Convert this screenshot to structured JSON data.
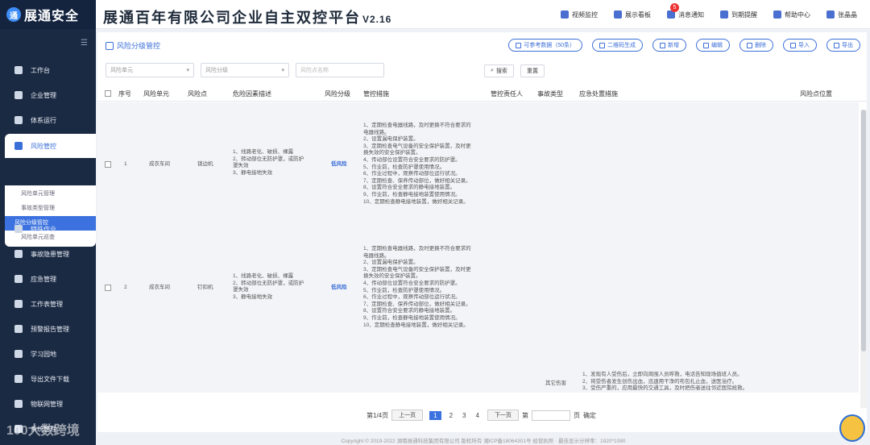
{
  "header": {
    "logo_mark": "通",
    "logo_text": "展通安全",
    "app_title": "展通百年有限公司企业自主双控平台",
    "version": "V2.16",
    "nav": [
      {
        "label": "视频监控",
        "icon": "video-icon"
      },
      {
        "label": "展示看板",
        "icon": "dashboard-icon"
      },
      {
        "label": "消息通知",
        "icon": "bell-icon",
        "badge": "5"
      },
      {
        "label": "到期提醒",
        "icon": "clock-icon"
      },
      {
        "label": "帮助中心",
        "icon": "help-icon"
      },
      {
        "label": "张晶晶",
        "icon": "user-icon"
      }
    ]
  },
  "sidebar": {
    "collapse_glyph": "☰",
    "items": [
      {
        "label": "工作台",
        "icon": "workbench-icon"
      },
      {
        "label": "企业管理",
        "icon": "home-icon"
      },
      {
        "label": "体系运行",
        "icon": "layers-icon"
      },
      {
        "label": "风险管控",
        "icon": "risk-icon"
      },
      {
        "label": "特殊作业",
        "icon": "hammer-icon"
      },
      {
        "label": "事故隐患管理",
        "icon": "hazard-icon"
      },
      {
        "label": "应急管理",
        "icon": "emergency-icon"
      },
      {
        "label": "工作表管理",
        "icon": "calendar-icon"
      },
      {
        "label": "预警报告管理",
        "icon": "report-icon"
      },
      {
        "label": "学习园地",
        "icon": "study-icon"
      },
      {
        "label": "导出文件下载",
        "icon": "download-icon"
      },
      {
        "label": "物联网管理",
        "icon": "iot-icon"
      },
      {
        "label": "系统管理",
        "icon": "settings-icon"
      }
    ],
    "submenu": [
      "风险单元管理",
      "事故类型管理",
      "风险分级管控",
      "风险单元巡查"
    ]
  },
  "panel": {
    "title": "风险分级管控",
    "toolbar": [
      {
        "label": "可参考数据（50条）",
        "icon": "eye-icon"
      },
      {
        "label": "二维码生成",
        "icon": "qrcode-icon"
      },
      {
        "label": "新增",
        "icon": "plus-icon"
      },
      {
        "label": "编辑",
        "icon": "edit-icon"
      },
      {
        "label": "删除",
        "icon": "delete-icon"
      },
      {
        "label": "导入",
        "icon": "import-icon"
      },
      {
        "label": "导出",
        "icon": "export-icon"
      }
    ],
    "filters": {
      "unit_placeholder": "风险单元",
      "level_placeholder": "风险分级",
      "point_placeholder": "风险点名称",
      "search_label": "搜索",
      "reset_label": "重置"
    }
  },
  "table": {
    "columns": [
      "序号",
      "风险单元",
      "风险点",
      "危险因素描述",
      "风险分级",
      "管控措施",
      "管控责任人",
      "事故类型",
      "应急处置措施",
      "风险点位置"
    ],
    "rows": [
      {
        "no": "1",
        "unit": "成衣车间",
        "point": "锁边机",
        "factors": [
          "1、线路老化、破损、裸露",
          "2、转动部位无防护罩，或防护",
          "罩失效",
          "3、静电接地失效"
        ],
        "level": "低风险",
        "measures": [
          "1、定期检查电器线路，及时更换不符合要求的",
          "电器线路。",
          "2、设置漏电保护装置。",
          "3、定期检查电气设备的安全保护装置，及时更",
          "换失效的安全保护装置。",
          "4、传动部位设置符合安全要求的防护罩。",
          "5、作业前，检查防护罩使用情况。",
          "6、作业过程中，观察传动部位运行状况。",
          "7、定期检查、保养传动部位，做好相关记录。",
          "8、设置符合安全要求的静电接地装置。",
          "9、作业前，检查静电接地装置使用情况。",
          "10、定期检查静电接地装置，做好相关记录。"
        ]
      },
      {
        "no": "2",
        "unit": "成衣车间",
        "point": "钉扣机",
        "factors": [
          "1、线路老化、破损、裸露",
          "2、转动部位无防护罩，或防护",
          "罩失效",
          "3、静电接地失效"
        ],
        "level": "低风险",
        "measures": [
          "1、定期检查电器线路，及时更换不符合要求的",
          "电器线路。",
          "2、设置漏电保护装置。",
          "3、定期检查电气设备的安全保护装置，及时更",
          "换失效的安全保护装置。",
          "4、传动部位设置符合安全要求的防护罩。",
          "5、作业前，检查防护罩使用情况。",
          "6、作业过程中，观察传动部位运行状况。",
          "7、定期检查、保养传动部位，做好相关记录。",
          "8、设置符合安全要求的静电接地装置。",
          "9、作业前，检查静电接地装置使用情况。",
          "10、定期检查静电接地装置，做好相关记录。"
        ]
      }
    ],
    "extra_row": {
      "accident_type": "其它伤害",
      "emergency": [
        "1、发现有人受伤后，立即向周围人员呼救，电话告知现场值班人员。",
        "2、将受伤者发生创伤出血，迅速用干净的布包扎止血，送医治疗。",
        "3、受伤严重的，应用最快的交通工具，及时把伤者送往邻近医院抢救。"
      ]
    }
  },
  "pagination": {
    "summary": "第1/4页",
    "prev": "上一页",
    "pages": [
      "1",
      "2",
      "3",
      "4"
    ],
    "current": "1",
    "next": "下一页",
    "goto_prefix": "第",
    "goto_suffix": "页",
    "confirm": "确定"
  },
  "footer": {
    "text": "Copyright © 2019-2022 湖南展通科技集团有限公司 版权所有 湘ICP备18064301号 经营执照 · 最佳显示分辨率：1920*1080"
  },
  "watermark": "100大数跨境"
}
